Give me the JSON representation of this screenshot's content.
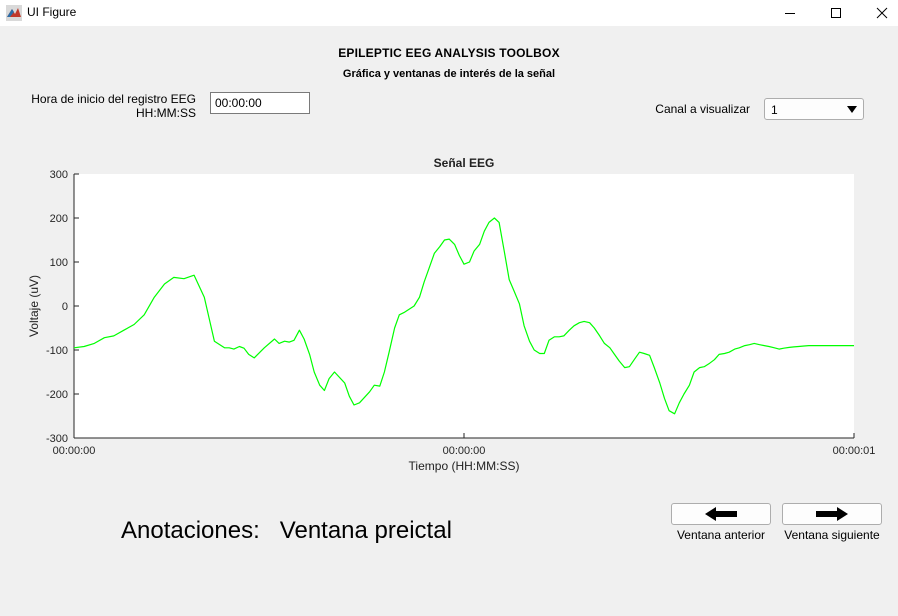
{
  "window": {
    "title": "UI Figure",
    "icon": "matlab-icon",
    "controls": [
      "minimize-icon",
      "maximize-icon",
      "close-icon"
    ]
  },
  "header": {
    "title": "EPILEPTIC EEG ANALYSIS TOOLBOX",
    "subtitle": "Gráfica y ventanas de interés de la señal"
  },
  "start_time": {
    "label_line1": "Hora de inicio del registro EEG",
    "label_line2": "HH:MM:SS",
    "value": "00:00:00"
  },
  "channel": {
    "label": "Canal a visualizar",
    "selected": "1"
  },
  "chart_data": {
    "type": "line",
    "title": "Señal EEG",
    "xlabel": "Tiempo (HH:MM:SS)",
    "ylabel": "Voltaje (uV)",
    "xlim": [
      0,
      1
    ],
    "ylim": [
      -300,
      300
    ],
    "x_tick_values": [
      0,
      0.5,
      1
    ],
    "x_tick_labels": [
      "00:00:00",
      "00:00:00",
      "00:00:01"
    ],
    "y_ticks": [
      300,
      200,
      100,
      0,
      -100,
      -200,
      -300
    ],
    "grid": false,
    "line_color": "#00ff00",
    "series": [
      {
        "x": [
          0,
          0.013,
          0.026,
          0.039,
          0.051,
          0.064,
          0.077,
          0.09,
          0.103,
          0.116,
          0.128,
          0.141,
          0.154,
          0.167,
          0.18,
          0.193,
          0.199,
          0.205,
          0.212,
          0.218,
          0.224,
          0.231,
          0.244,
          0.257,
          0.263,
          0.27,
          0.276,
          0.282,
          0.289,
          0.295,
          0.302,
          0.308,
          0.315,
          0.321,
          0.327,
          0.334,
          0.347,
          0.353,
          0.359,
          0.366,
          0.379,
          0.385,
          0.392,
          0.398,
          0.404,
          0.411,
          0.417,
          0.423,
          0.436,
          0.443,
          0.449,
          0.456,
          0.462,
          0.469,
          0.475,
          0.481,
          0.488,
          0.494,
          0.5,
          0.507,
          0.513,
          0.52,
          0.526,
          0.532,
          0.539,
          0.545,
          0.552,
          0.558,
          0.564,
          0.571,
          0.577,
          0.584,
          0.59,
          0.597,
          0.603,
          0.609,
          0.616,
          0.622,
          0.628,
          0.635,
          0.641,
          0.648,
          0.654,
          0.661,
          0.667,
          0.674,
          0.68,
          0.687,
          0.693,
          0.699,
          0.706,
          0.712,
          0.719,
          0.725,
          0.731,
          0.738,
          0.744,
          0.751,
          0.757,
          0.763,
          0.77,
          0.776,
          0.782,
          0.789,
          0.795,
          0.802,
          0.808,
          0.815,
          0.821,
          0.827,
          0.834,
          0.84,
          0.847,
          0.853,
          0.86,
          0.866,
          0.872,
          0.879,
          0.885,
          0.891,
          0.898,
          0.904,
          0.91,
          0.917,
          0.923,
          0.929,
          0.936,
          0.942,
          0.949,
          0.955,
          0.961,
          0.968,
          0.974,
          0.981,
          0.987,
          0.994,
          1.0
        ],
        "y": [
          -95,
          -92,
          -85,
          -72,
          -68,
          -55,
          -42,
          -20,
          20,
          50,
          65,
          62,
          70,
          20,
          -80,
          -95,
          -95,
          -98,
          -92,
          -96,
          -110,
          -118,
          -95,
          -75,
          -85,
          -80,
          -82,
          -78,
          -55,
          -75,
          -110,
          -150,
          -180,
          -192,
          -165,
          -150,
          -175,
          -205,
          -225,
          -220,
          -195,
          -180,
          -182,
          -150,
          -105,
          -50,
          -20,
          -15,
          0,
          20,
          55,
          90,
          120,
          135,
          150,
          152,
          140,
          115,
          95,
          100,
          125,
          140,
          170,
          190,
          200,
          190,
          120,
          60,
          35,
          5,
          -45,
          -80,
          -100,
          -108,
          -108,
          -78,
          -70,
          -70,
          -68,
          -55,
          -45,
          -38,
          -35,
          -38,
          -50,
          -68,
          -85,
          -95,
          -110,
          -125,
          -140,
          -138,
          -120,
          -105,
          -108,
          -112,
          -140,
          -175,
          -210,
          -238,
          -245,
          -220,
          -200,
          -180,
          -150,
          -140,
          -138,
          -130,
          -122,
          -110,
          -108,
          -105,
          -98,
          -95,
          -90,
          -88,
          -85,
          -88,
          -90,
          -92,
          -95,
          -98,
          -96,
          -94,
          -93,
          -92,
          -91,
          -90,
          -90,
          -90,
          -90,
          -90,
          -90,
          -90,
          -90,
          -90,
          -90
        ]
      }
    ]
  },
  "annotations": {
    "label": "Anotaciones:",
    "value": "Ventana preictal"
  },
  "navigation": {
    "prev_icon": "arrow-left-icon",
    "next_icon": "arrow-right-icon",
    "prev_label": "Ventana anterior",
    "next_label": "Ventana siguiente"
  }
}
